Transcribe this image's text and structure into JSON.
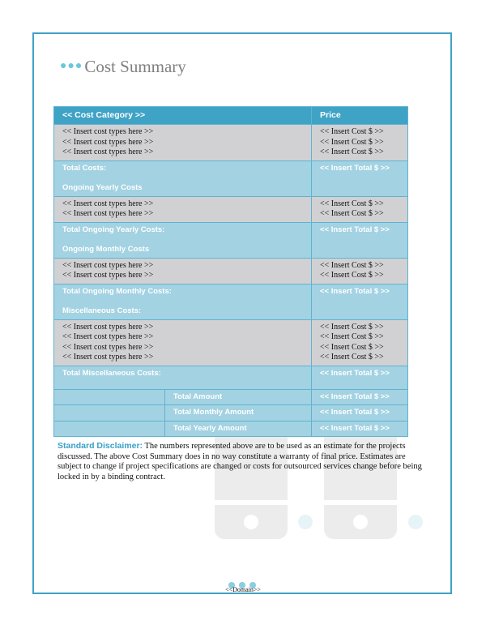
{
  "title": "Cost Summary",
  "table": {
    "header": {
      "category": "<< Cost Category >>",
      "price": "Price"
    },
    "sections": [
      {
        "items": [
          "<< Insert cost types here >>",
          "<< Insert cost types here >>",
          "<< Insert cost types here >>"
        ],
        "prices": [
          "<< Insert Cost $ >>",
          "<< Insert Cost $ >>",
          "<< Insert Cost $ >>"
        ],
        "total_label": "Total Costs:",
        "total_value": "<< Insert Total $ >>",
        "next_heading": "Ongoing Yearly Costs"
      },
      {
        "items": [
          "<< Insert cost types here >>",
          "<< Insert cost types here >>"
        ],
        "prices": [
          "<< Insert Cost $ >>",
          "<< Insert Cost $ >>"
        ],
        "total_label": "Total Ongoing Yearly Costs:",
        "total_value": "<< Insert Total $ >>",
        "next_heading": "Ongoing Monthly Costs"
      },
      {
        "items": [
          "<< Insert cost types here >>",
          "<< Insert cost types here >>"
        ],
        "prices": [
          "<< Insert Cost $ >>",
          "<< Insert Cost $ >>"
        ],
        "total_label": "Total Ongoing Monthly Costs:",
        "total_value": "<< Insert Total $ >>",
        "next_heading": "Miscellaneous Costs:"
      },
      {
        "items": [
          "<< Insert cost types here >>",
          "<< Insert cost types here >>",
          "<< Insert cost types here >>",
          "<< Insert cost types here >>"
        ],
        "prices": [
          "<< Insert Cost $ >>",
          "<< Insert Cost $ >>",
          "<< Insert Cost $ >>",
          "<< Insert Cost $ >>"
        ],
        "total_label": "Total Miscellaneous Costs:",
        "total_value": "<< Insert Total $ >>",
        "next_heading": ""
      }
    ],
    "summary": [
      {
        "label": "Total Amount",
        "value": "<< Insert Total $ >>"
      },
      {
        "label": "Total Monthly Amount",
        "value": "<< Insert Total $ >>"
      },
      {
        "label": "Total Yearly Amount",
        "value": "<< Insert Total $ >>"
      }
    ]
  },
  "disclaimer": {
    "label": "Standard Disclaimer:",
    "text": " The numbers represented above are to be used as an estimate for the projects discussed. The above Cost Summary does in no way constitute a warranty of final price.  Estimates are subject to change if project specifications are changed or costs for outsourced services change before being locked in by a binding contract."
  },
  "footer": {
    "domain": "<<Domain>>"
  },
  "colors": {
    "accent": "#3fa3c6",
    "row_gray": "#d1d1d3",
    "row_blue": "#a3d2e2"
  }
}
